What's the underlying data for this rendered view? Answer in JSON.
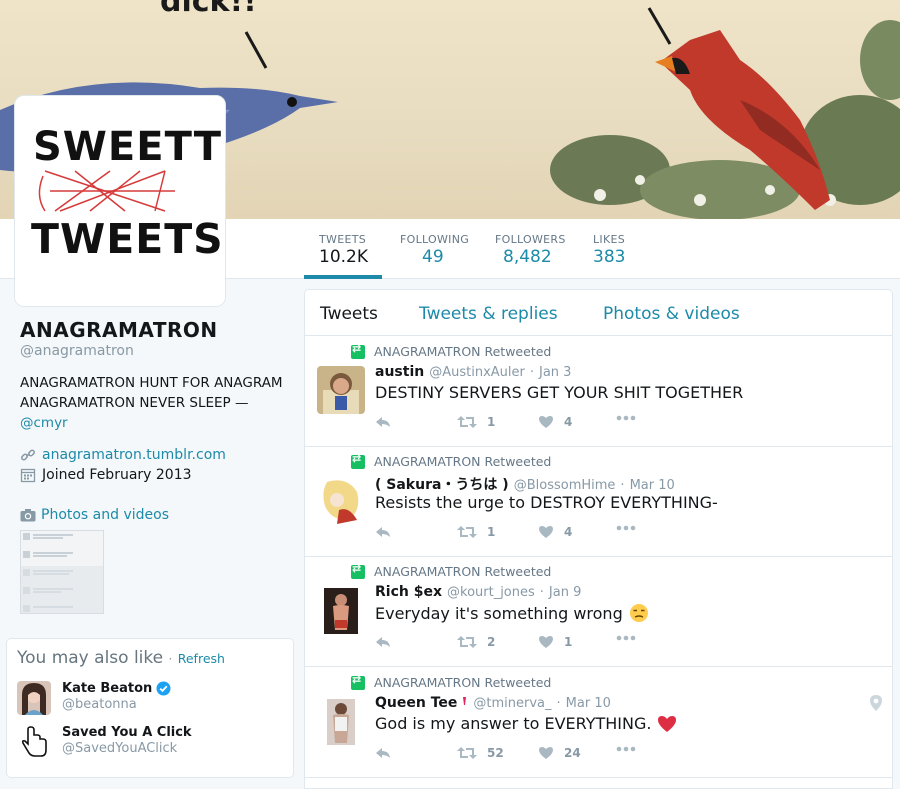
{
  "header": {
    "banner_caption": "dick!!"
  },
  "avatar": {
    "logo_text_top": "SWEETT",
    "logo_text_bottom": "TWEETS"
  },
  "nav": {
    "stats": [
      {
        "label": "TWEETS",
        "value": "10.2K"
      },
      {
        "label": "FOLLOWING",
        "value": "49"
      },
      {
        "label": "FOLLOWERS",
        "value": "8,482"
      },
      {
        "label": "LIKES",
        "value": "383"
      }
    ]
  },
  "profile": {
    "name": "ANAGRAMATRON",
    "handle": "@anagramatron",
    "bio": "ANAGRAMATRON HUNT FOR ANAGRAM ANAGRAMATRON NEVER SLEEP —",
    "bio_mention": "@cmyr",
    "website": "anagramatron.tumblr.com",
    "joined": "Joined February 2013",
    "photos_link": "Photos and videos"
  },
  "who_to_follow": {
    "title": "You may also like",
    "refresh": "Refresh",
    "dot": "·",
    "users": [
      {
        "name": "Kate Beaton",
        "handle": "@beatonna",
        "verified": true
      },
      {
        "name": "Saved You A Click",
        "handle": "@SavedYouAClick",
        "verified": false
      }
    ]
  },
  "timeline": {
    "tabs": [
      "Tweets",
      "Tweets & replies",
      "Photos & videos"
    ],
    "tweets": [
      {
        "retweeted_by": "ANAGRAMATRON Retweeted",
        "name": "austin",
        "handle": "@AustinxAuler",
        "date": "Jan 3",
        "text": "DESTINY SERVERS GET YOUR SHIT TOGETHER",
        "retweets": "1",
        "likes": "4"
      },
      {
        "retweeted_by": "ANAGRAMATRON Retweeted",
        "name": "( Sakura・うちは )",
        "handle": "@BlossomHime",
        "date": "Mar 10",
        "text": "Resists the urge to DESTROY EVERYTHING-",
        "retweets": "1",
        "likes": "4"
      },
      {
        "retweeted_by": "ANAGRAMATRON Retweeted",
        "name": "Rich $ex",
        "handle": "@kourt_jones",
        "date": "Jan 9",
        "text": "Everyday it's something wrong",
        "retweets": "2",
        "likes": "1"
      },
      {
        "retweeted_by": "ANAGRAMATRON Retweeted",
        "name": "Queen Tee",
        "handle": "@tminerva_",
        "date": "Mar 10",
        "text": "God is my answer to EVERYTHING.",
        "retweets": "52",
        "likes": "24"
      }
    ]
  },
  "colors": {
    "accent": "#1c8aa8",
    "retweet_green": "#17bf63",
    "heart_red": "#e0245e",
    "muted": "#8899a6"
  }
}
